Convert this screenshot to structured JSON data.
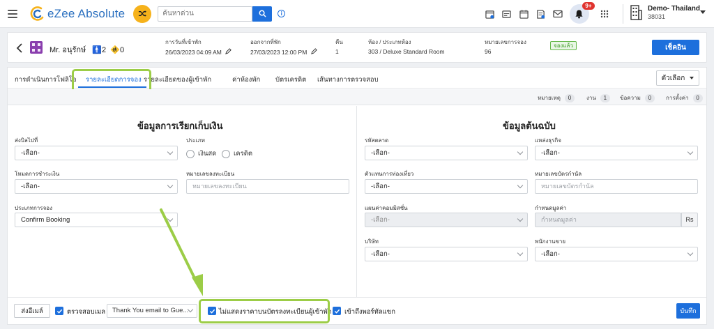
{
  "header": {
    "logo_text": "eZee Absolute",
    "search_placeholder": "ค้นหาด่วน",
    "notification_count": "9+",
    "property_name": "Demo- Thailand",
    "property_id": "38031"
  },
  "guest": {
    "name": "Mr. อนุรักษ์",
    "adults": "2",
    "children": "0",
    "arrival_label": "การวันที่เข้าพัก",
    "arrival_value": "26/03/2023 04:09 AM",
    "departure_label": "ออกจากที่พัก",
    "departure_value": "27/03/2023 12:00 PM",
    "nights_label": "คืน",
    "nights_value": "1",
    "room_label": "ห้อง / ประเภทห้อง",
    "room_value": "303 / Deluxe Standard Room",
    "res_label": "หมายเลขการจอง",
    "res_value": "96",
    "status": "จองแล้ว",
    "checkin_label": "เช็คอิน"
  },
  "tabs": [
    {
      "label": "การดำเนินการโฟลิโอ"
    },
    {
      "label": "รายละเอียดการจอง"
    },
    {
      "label": "รายละเอียดของผู้เข้าพัก"
    },
    {
      "label": "ค่าห้องพัก"
    },
    {
      "label": "บัตรเครดิต"
    },
    {
      "label": "เส้นทางการตรวจสอบ"
    }
  ],
  "options_label": "ตัวเลือก",
  "counters": [
    {
      "label": "หมายเหตุ",
      "count": "0"
    },
    {
      "label": "งาน",
      "count": "1"
    },
    {
      "label": "ข้อความ",
      "count": "0"
    },
    {
      "label": "การตั้งค่า",
      "count": "0"
    }
  ],
  "billing": {
    "title": "ข้อมูลการเรียกเก็บเงิน",
    "bill_to_label": "ส่งบิลไปที่",
    "bill_to_value": "-เลือก-",
    "type_label": "ประเภท",
    "radio_cash": "เงินสด",
    "radio_credit": "เครดิต",
    "payment_mode_label": "โหมดการชำระเงิน",
    "payment_mode_value": "-เลือก-",
    "reg_no_label": "หมายเลขลงทะเบียน",
    "reg_no_placeholder": "หมายเลขลงทะเบียน",
    "booking_type_label": "ประเภทการจอง",
    "booking_type_value": "Confirm Booking"
  },
  "source": {
    "title": "ข้อมูลต้นฉบับ",
    "market_label": "รหัสตลาด",
    "market_value": "-เลือก-",
    "business_source_label": "แหล่งธุรกิจ",
    "business_source_value": "-เลือก-",
    "travel_agent_label": "ตัวแทนการท่องเที่ยว",
    "travel_agent_value": "-เลือก-",
    "voucher_label": "หมายเลขบัตรกำนัล",
    "voucher_placeholder": "หมายเลขบัตรกำนัล",
    "commission_plan_label": "แผนค่าคอมมิสชั่น",
    "commission_plan_value": "-เลือก-",
    "value_label": "กำหนดมูลค่า",
    "value_placeholder": "กำหนดมูลค่า",
    "currency": "Rs",
    "company_label": "บริษัท",
    "company_value": "-เลือก-",
    "salesperson_label": "พนักงานขาย",
    "salesperson_value": "-เลือก-"
  },
  "footer": {
    "send_email_label": "ส่งอีเมล์",
    "check_email_label": "ตรวจสอบเมล",
    "email_template": "Thank You email to Gue...",
    "hide_rate_label": "ไม่แสดงราคาบนบัตรลงทะเบียนผู้เข้าพัก",
    "portal_access_label": "เข้าถึงพอร์ทัลแขก",
    "save_label": "บันทึก"
  },
  "colors": {
    "primary": "#1d6fdc",
    "highlight": "#9ccd47",
    "status_green": "#3b9b22",
    "accent_orange": "#f6b21b"
  }
}
